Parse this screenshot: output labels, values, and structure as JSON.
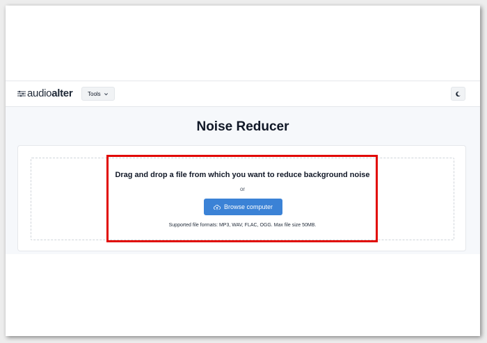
{
  "brand": {
    "logo_light": "audio",
    "logo_bold": "alter",
    "logo_icon": "sliders-icon"
  },
  "navbar": {
    "tools_label": "Tools",
    "tools_icon": "chevron-down-icon",
    "theme_icon": "moon-icon"
  },
  "page": {
    "title": "Noise Reducer"
  },
  "upload": {
    "heading": "Drag and drop a file from which you want to reduce background noise",
    "or_text": "or",
    "browse_label": "Browse computer",
    "browse_icon": "cloud-upload-icon",
    "formats_text": "Supported file formats: MP3, WAV, FLAC, OGG. Max file size 50MB."
  },
  "colors": {
    "accent": "#3b82d6",
    "highlight": "#e10600",
    "page_bg": "#f6f8fb"
  }
}
